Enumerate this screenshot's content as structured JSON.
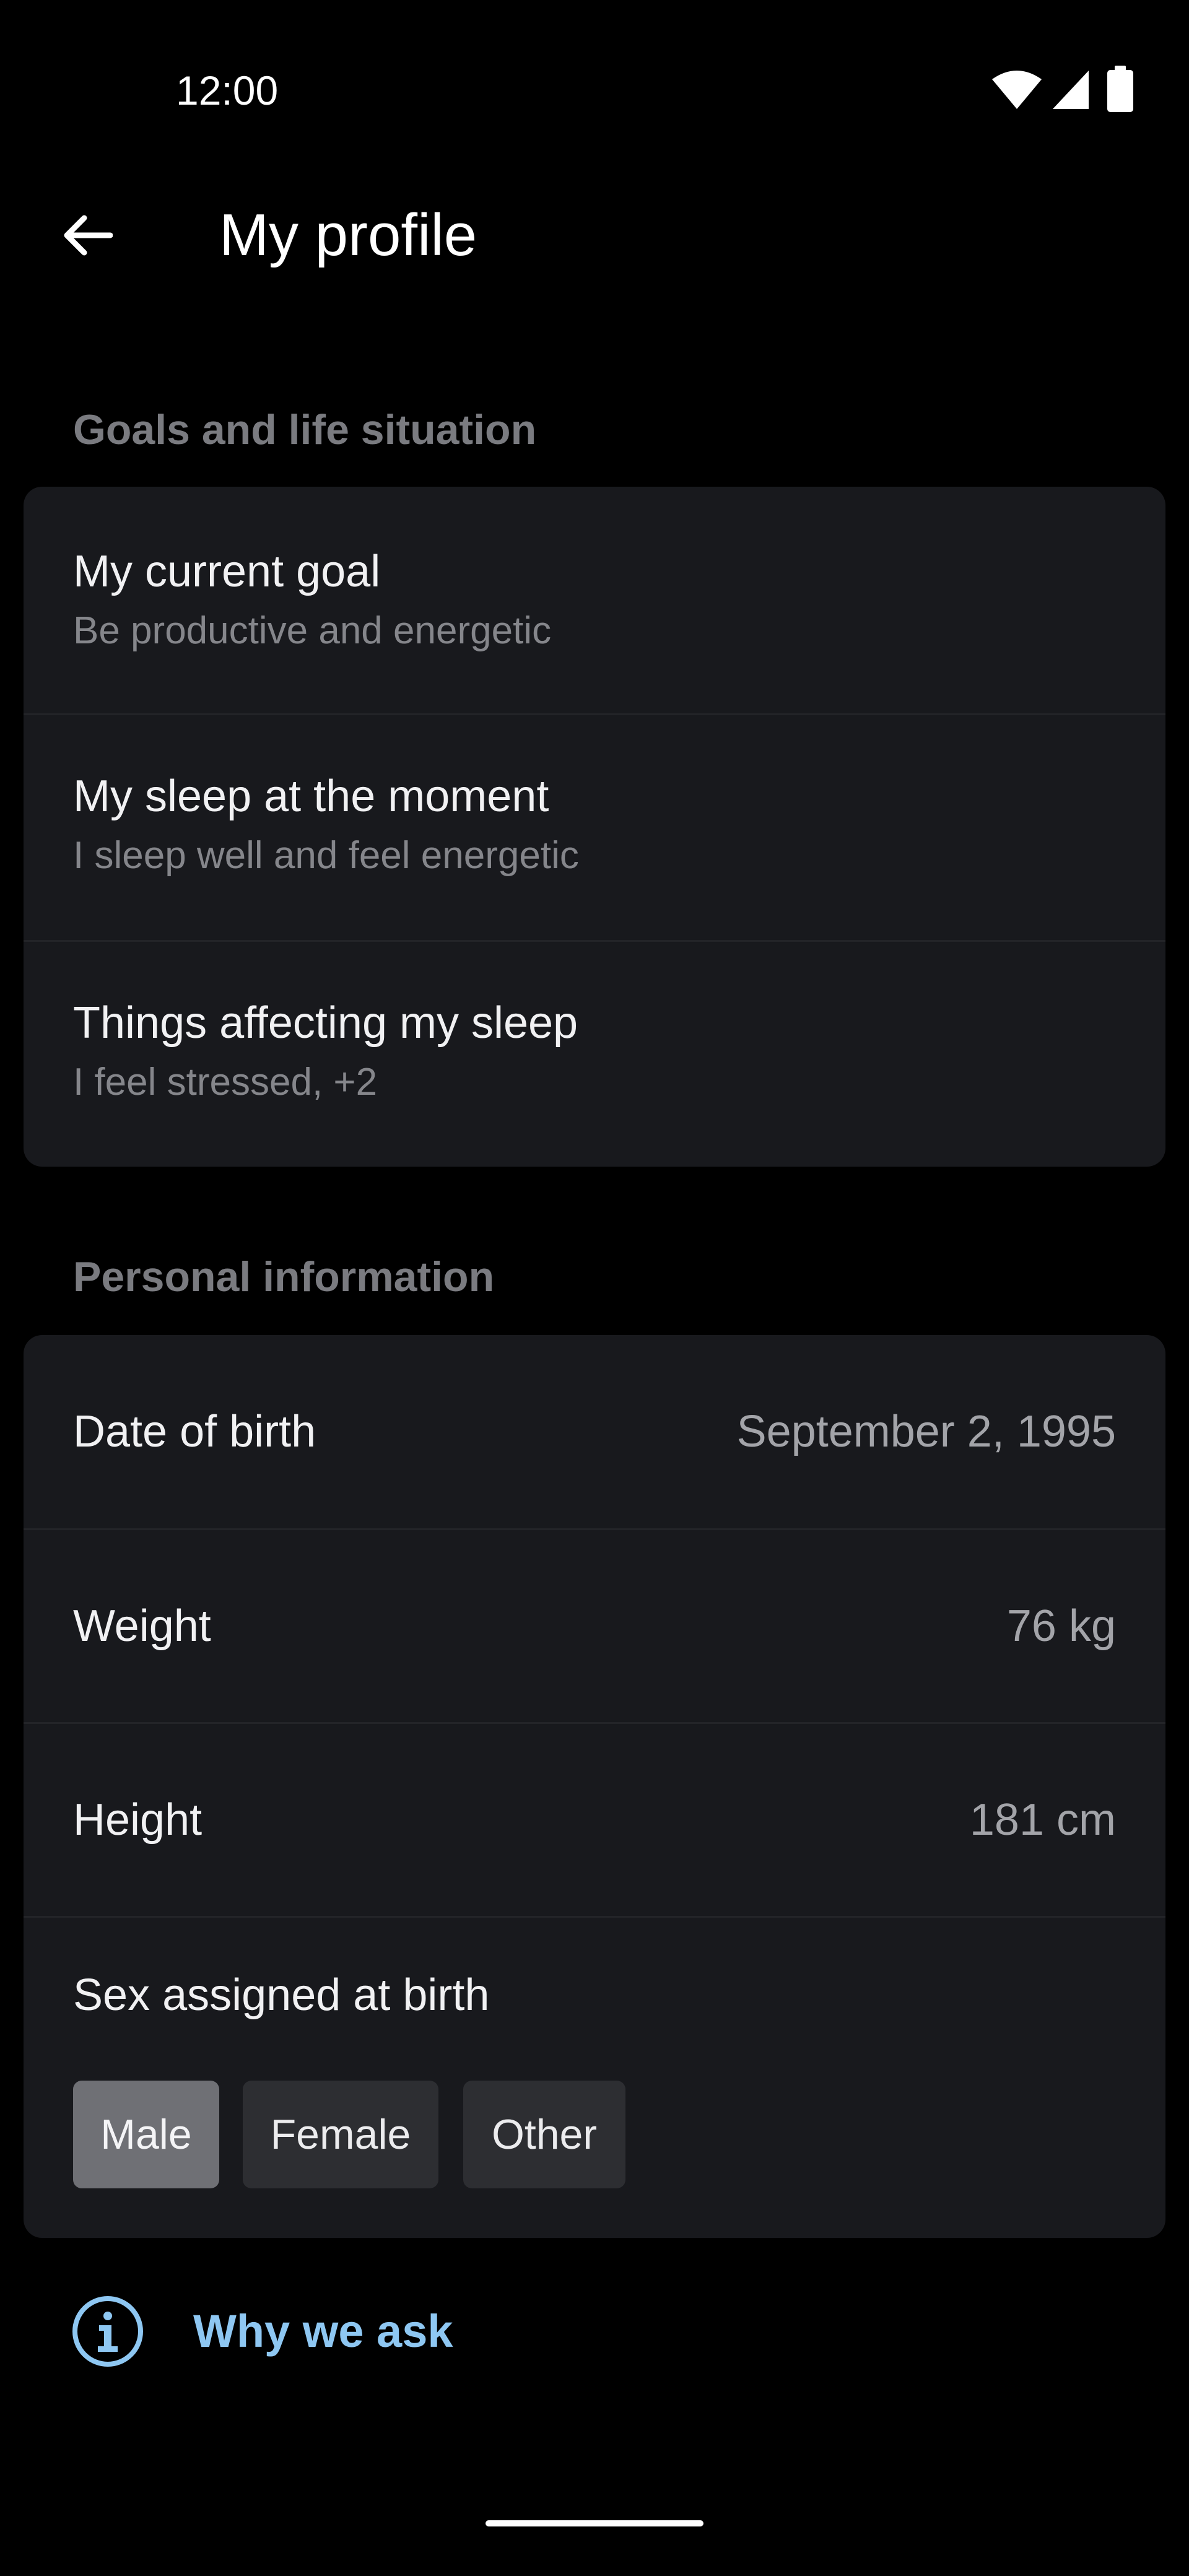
{
  "status_bar": {
    "time": "12:00"
  },
  "header": {
    "title": "My profile"
  },
  "goals_section": {
    "title": "Goals and life situation",
    "items": [
      {
        "title": "My current goal",
        "subtitle": "Be productive and energetic"
      },
      {
        "title": "My sleep at the moment",
        "subtitle": "I sleep well and feel energetic"
      },
      {
        "title": "Things affecting my sleep",
        "subtitle": "I feel stressed, +2"
      }
    ]
  },
  "personal_section": {
    "title": "Personal information",
    "date_of_birth": {
      "label": "Date of birth",
      "value": "September 2, 1995"
    },
    "weight": {
      "label": "Weight",
      "value": "76 kg"
    },
    "height": {
      "label": "Height",
      "value": "181 cm"
    },
    "sex": {
      "label": "Sex assigned at birth",
      "options": [
        "Male",
        "Female",
        "Other"
      ],
      "selected": "Male"
    }
  },
  "why_we_ask": {
    "label": "Why we ask",
    "icon": "info-icon"
  },
  "colors": {
    "background": "#000000",
    "card": "#18191D",
    "link": "#8EC7F2",
    "chip_selected": "#6F7075",
    "chip": "#2D2E32"
  }
}
